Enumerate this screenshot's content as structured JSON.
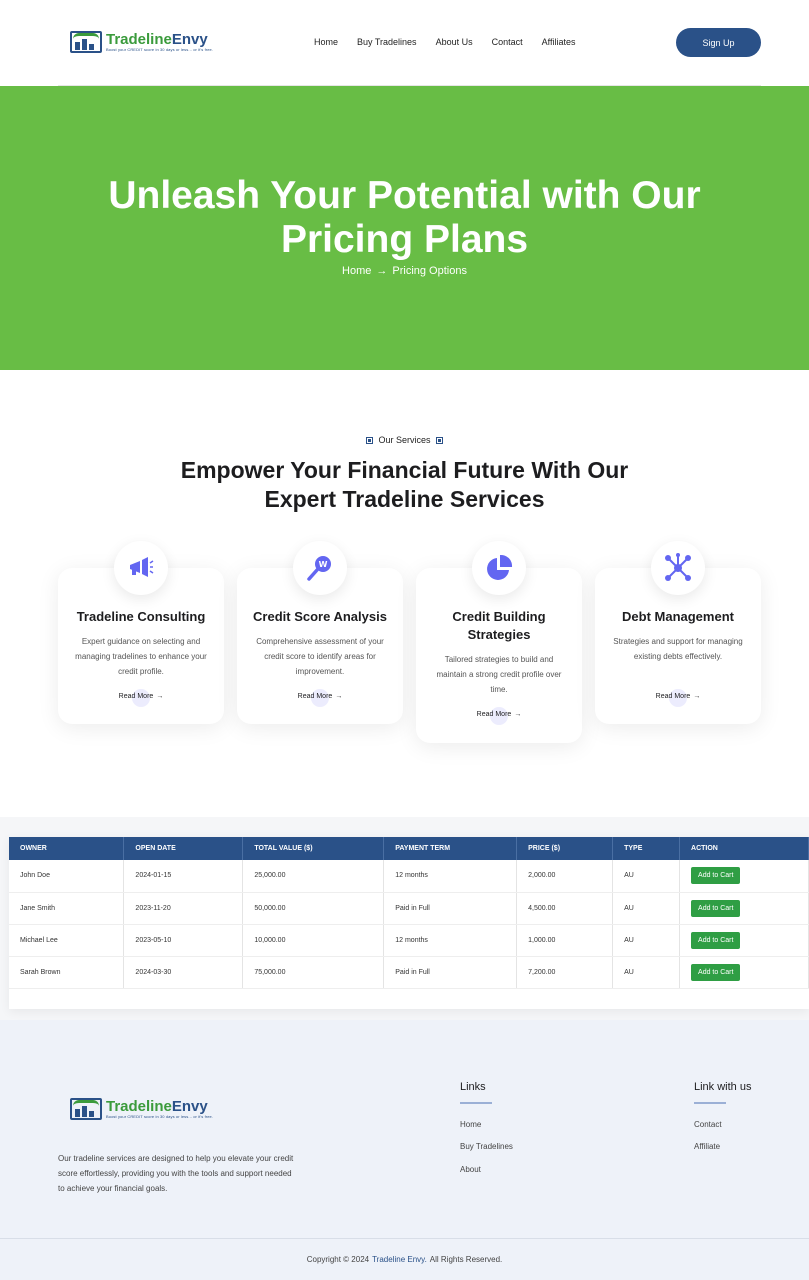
{
  "header": {
    "logo": {
      "name_part1": "Tradeline",
      "name_part2": "Envy",
      "tagline": "Boost your CREDIT score in 30 days or less... or it's free."
    },
    "nav": [
      "Home",
      "Buy Tradelines",
      "About Us",
      "Contact",
      "Affiliates"
    ],
    "signup_label": "Sign Up"
  },
  "hero": {
    "title": "Unleash Your Potential with Our Pricing Plans",
    "breadcrumb_home": "Home",
    "breadcrumb_arrow": "→",
    "breadcrumb_current": "Pricing Options"
  },
  "services": {
    "eyebrow": "Our Services",
    "title": "Empower Your Financial Future With Our Expert Tradeline Services",
    "cards": [
      {
        "title": "Tradeline Consulting",
        "desc": "Expert guidance on selecting and managing tradelines to enhance your credit profile.",
        "link": "Read More",
        "icon": "megaphone-icon"
      },
      {
        "title": "Credit Score Analysis",
        "desc": "Comprehensive assessment of your credit score to identify areas for improvement.",
        "link": "Read More",
        "icon": "magnifier-icon"
      },
      {
        "title": "Credit Building Strategies",
        "desc": "Tailored strategies to build and maintain a strong credit profile over time.",
        "link": "Read More",
        "icon": "pie-chart-icon"
      },
      {
        "title": "Debt Management",
        "desc": "Strategies and support for managing existing debts effectively.",
        "link": "Read More",
        "icon": "network-icon"
      }
    ],
    "arrow": "→"
  },
  "table": {
    "headers": [
      "OWNER",
      "OPEN DATE",
      "TOTAL VALUE ($)",
      "PAYMENT TERM",
      "PRICE ($)",
      "TYPE",
      "ACTION"
    ],
    "rows": [
      [
        "John Doe",
        "2024-01-15",
        "25,000.00",
        "12 months",
        "2,000.00",
        "AU",
        "Add to Cart"
      ],
      [
        "Jane Smith",
        "2023-11-20",
        "50,000.00",
        "Paid in Full",
        "4,500.00",
        "AU",
        "Add to Cart"
      ],
      [
        "Michael Lee",
        "2023-05-10",
        "10,000.00",
        "12 months",
        "1,000.00",
        "AU",
        "Add to Cart"
      ],
      [
        "Sarah Brown",
        "2024-03-30",
        "75,000.00",
        "Paid in Full",
        "7,200.00",
        "AU",
        "Add to Cart"
      ]
    ]
  },
  "footer": {
    "description": "Our tradeline services are designed to help you elevate your credit score effortlessly, providing you with the tools and support needed to achieve your financial goals.",
    "links_title": "Links",
    "links": [
      "Home",
      "Buy Tradelines",
      "About"
    ],
    "link_with_us_title": "Link with us",
    "link_with_us": [
      "Contact",
      "Affiliate"
    ],
    "copyright_prefix": "Copyright © 2024",
    "copyright_brand": "Tradeline Envy.",
    "copyright_suffix": "All Rights Reserved."
  },
  "colors": {
    "green": "#68bd45",
    "blue": "#2a5188",
    "icon": "#6366f1",
    "cart": "#2f9e44"
  }
}
